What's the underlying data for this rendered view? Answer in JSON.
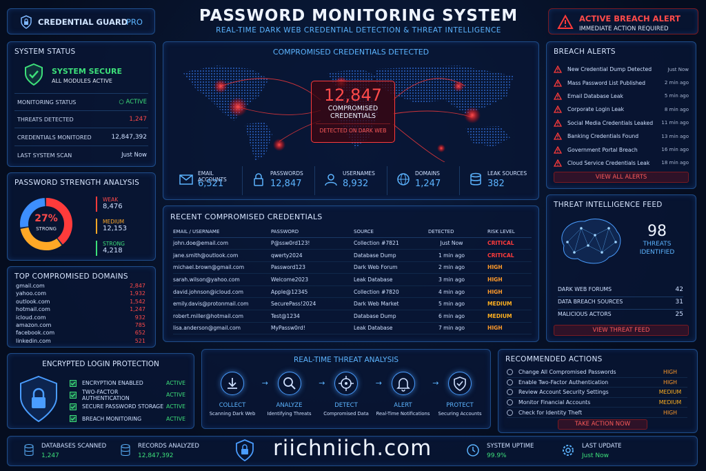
{
  "brand": {
    "name": "CREDENTIAL GUARD",
    "suffix": "PRO"
  },
  "header": {
    "title": "PASSWORD MONITORING SYSTEM",
    "subtitle": "REAL-TIME DARK WEB CREDENTIAL DETECTION & THREAT INTELLIGENCE"
  },
  "alert_banner": {
    "title": "ACTIVE BREACH ALERT",
    "sub": "IMMEDIATE ACTION REQUIRED"
  },
  "system_status": {
    "title": "SYSTEM STATUS",
    "state": "SYSTEM SECURE",
    "state_sub": "ALL MODULES ACTIVE",
    "rows": [
      {
        "label": "MONITORING STATUS",
        "value": "ACTIVE"
      },
      {
        "label": "THREATS DETECTED",
        "value": "1,247"
      },
      {
        "label": "CREDENTIALS MONITORED",
        "value": "12,847,392"
      },
      {
        "label": "LAST SYSTEM SCAN",
        "value": "Just Now"
      }
    ]
  },
  "strength": {
    "title": "PASSWORD STRENGTH ANALYSIS",
    "center_pct": "27%",
    "center_label": "STRONG",
    "items": [
      {
        "label": "WEAK",
        "value": "8,476",
        "pct": 0.4,
        "color": "#ff3b3b"
      },
      {
        "label": "MEDIUM",
        "value": "12,153",
        "pct": 0.33,
        "color": "#ffa826"
      },
      {
        "label": "STRONG",
        "value": "4,218",
        "pct": 0.27,
        "color": "#3d8fff"
      }
    ]
  },
  "domains": {
    "title": "TOP COMPROMISED DOMAINS",
    "items": [
      {
        "name": "gmail.com",
        "count": "2,847"
      },
      {
        "name": "yahoo.com",
        "count": "1,932"
      },
      {
        "name": "outlook.com",
        "count": "1,542"
      },
      {
        "name": "hotmail.com",
        "count": "1,247"
      },
      {
        "name": "icloud.com",
        "count": "932"
      },
      {
        "name": "amazon.com",
        "count": "785"
      },
      {
        "name": "facebook.com",
        "count": "652"
      },
      {
        "name": "linkedin.com",
        "count": "521"
      }
    ]
  },
  "map": {
    "title": "COMPROMISED CREDENTIALS DETECTED",
    "count": "12,847",
    "label1": "COMPROMISED",
    "label2": "CREDENTIALS",
    "foot": "DETECTED ON DARK WEB"
  },
  "stats": [
    {
      "icon": "mail-icon",
      "label": "EMAIL ACCOUNTS",
      "value": "6,521"
    },
    {
      "icon": "lock-icon",
      "label": "PASSWORDS",
      "value": "12,847"
    },
    {
      "icon": "user-icon",
      "label": "USERNAMES",
      "value": "8,932"
    },
    {
      "icon": "globe-icon",
      "label": "DOMAINS",
      "value": "1,247"
    },
    {
      "icon": "database-icon",
      "label": "LEAK SOURCES",
      "value": "382"
    }
  ],
  "recent": {
    "title": "RECENT COMPROMISED CREDENTIALS",
    "headers": [
      "EMAIL / USERNAME",
      "PASSWORD",
      "SOURCE",
      "DETECTED",
      "RISK LEVEL"
    ],
    "rows": [
      [
        "john.doe@email.com",
        "P@ssw0rd123!",
        "Collection #7821",
        "Just Now",
        "CRITICAL"
      ],
      [
        "jane.smith@outlook.com",
        "qwerty2024",
        "Database Dump",
        "1 min ago",
        "CRITICAL"
      ],
      [
        "michael.brown@gmail.com",
        "Password123",
        "Dark Web Forum",
        "2 min ago",
        "HIGH"
      ],
      [
        "sarah.wilson@yahoo.com",
        "Welcome2023",
        "Leak Database",
        "3 min ago",
        "HIGH"
      ],
      [
        "david.johnson@icloud.com",
        "Apple@12345",
        "Collection #7820",
        "4 min ago",
        "HIGH"
      ],
      [
        "emily.davis@protonmail.com",
        "SecurePass!2024",
        "Dark Web Market",
        "5 min ago",
        "MEDIUM"
      ],
      [
        "robert.miller@hotmail.com",
        "Test@1234",
        "Database Dump",
        "6 min ago",
        "MEDIUM"
      ],
      [
        "lisa.anderson@gmail.com",
        "MyPassw0rd!",
        "Leak Database",
        "7 min ago",
        "HIGH"
      ]
    ]
  },
  "breach": {
    "title": "BREACH ALERTS",
    "button": "VIEW ALL ALERTS",
    "items": [
      {
        "text": "New Credential Dump Detected",
        "time": "Just Now"
      },
      {
        "text": "Mass Password List Published",
        "time": "2 min ago"
      },
      {
        "text": "Email Database Leak",
        "time": "5 min ago"
      },
      {
        "text": "Corporate Login Leak",
        "time": "8 min ago"
      },
      {
        "text": "Social Media Credentials Leaked",
        "time": "11 min ago"
      },
      {
        "text": "Banking Credentials Found",
        "time": "13 min ago"
      },
      {
        "text": "Government Portal Breach",
        "time": "16 min ago"
      },
      {
        "text": "Cloud Service Credentials Leak",
        "time": "18 min ago"
      }
    ]
  },
  "intel": {
    "title": "THREAT INTELLIGENCE FEED",
    "count": "98",
    "label1": "THREATS",
    "label2": "IDENTIFIED",
    "button": "VIEW THREAT FEED",
    "rows": [
      {
        "label": "DARK WEB FORUMS",
        "value": "42"
      },
      {
        "label": "DATA BREACH SOURCES",
        "value": "31"
      },
      {
        "label": "MALICIOUS ACTORS",
        "value": "25"
      }
    ]
  },
  "encrypt": {
    "title": "ENCRYPTED LOGIN PROTECTION",
    "items": [
      {
        "label": "ENCRYPTION ENABLED",
        "status": "ACTIVE"
      },
      {
        "label": "TWO-FACTOR AUTHENTICATION",
        "status": "ACTIVE"
      },
      {
        "label": "SECURE PASSWORD STORAGE",
        "status": "ACTIVE"
      },
      {
        "label": "BREACH MONITORING",
        "status": "ACTIVE"
      }
    ]
  },
  "analysis": {
    "title": "REAL-TIME THREAT ANALYSIS",
    "steps": [
      {
        "icon": "download-icon",
        "name": "COLLECT",
        "sub": "Scanning Dark Web"
      },
      {
        "icon": "magnifier-icon",
        "name": "ANALYZE",
        "sub": "Identifying Threats"
      },
      {
        "icon": "target-icon",
        "name": "DETECT",
        "sub": "Compromised Data"
      },
      {
        "icon": "bell-icon",
        "name": "ALERT",
        "sub": "Real-Time Notifications"
      },
      {
        "icon": "shield-icon",
        "name": "PROTECT",
        "sub": "Securing Accounts"
      }
    ]
  },
  "actions": {
    "title": "RECOMMENDED ACTIONS",
    "button": "TAKE ACTION NOW",
    "items": [
      {
        "text": "Change All Compromised Passwords",
        "level": "HIGH"
      },
      {
        "text": "Enable Two-Factor Authentication",
        "level": "HIGH"
      },
      {
        "text": "Review Account Security Settings",
        "level": "MEDIUM"
      },
      {
        "text": "Monitor Financial Accounts",
        "level": "MEDIUM"
      },
      {
        "text": "Check for Identity Theft",
        "level": "HIGH"
      }
    ]
  },
  "footer": {
    "db_label": "DATABASES SCANNED",
    "db_value": "1,247",
    "rec_label": "RECORDS ANALYZED",
    "rec_value": "12,847,392",
    "site": "riichniich.com",
    "uptime_label": "SYSTEM UPTIME",
    "uptime_value": "99.9%",
    "update_label": "LAST UPDATE",
    "update_value": "Just Now"
  },
  "colors": {
    "critical": "#ff3b3b",
    "high": "#ff7a2a",
    "medium": "#ffb020",
    "active": "#3de07a",
    "accent": "#5cb4ff"
  }
}
